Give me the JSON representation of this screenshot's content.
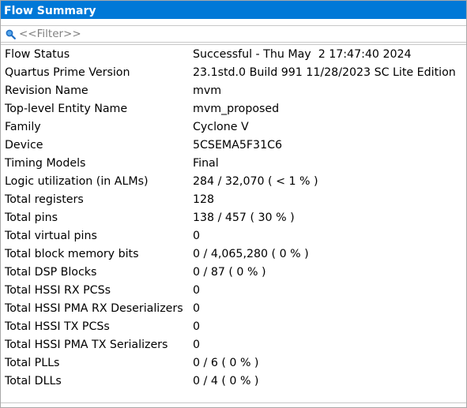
{
  "panel": {
    "title": "Flow Summary"
  },
  "filter": {
    "placeholder": "<<Filter>>",
    "value": ""
  },
  "icons": {
    "filter": "search-icon"
  },
  "colors": {
    "title_bg": "#0078d7",
    "title_fg": "#ffffff"
  },
  "rows": [
    {
      "key": "Flow Status",
      "value": "Successful - Thu May  2 17:47:40 2024"
    },
    {
      "key": "Quartus Prime Version",
      "value": "23.1std.0 Build 991 11/28/2023 SC Lite Edition"
    },
    {
      "key": "Revision Name",
      "value": "mvm"
    },
    {
      "key": "Top-level Entity Name",
      "value": "mvm_proposed"
    },
    {
      "key": "Family",
      "value": "Cyclone V"
    },
    {
      "key": "Device",
      "value": "5CSEMA5F31C6"
    },
    {
      "key": "Timing Models",
      "value": "Final"
    },
    {
      "key": "Logic utilization (in ALMs)",
      "value": "284 / 32,070 ( < 1 % )"
    },
    {
      "key": "Total registers",
      "value": "128"
    },
    {
      "key": "Total pins",
      "value": "138 / 457 ( 30 % )"
    },
    {
      "key": "Total virtual pins",
      "value": "0"
    },
    {
      "key": "Total block memory bits",
      "value": "0 / 4,065,280 ( 0 % )"
    },
    {
      "key": "Total DSP Blocks",
      "value": "0 / 87 ( 0 % )"
    },
    {
      "key": "Total HSSI RX PCSs",
      "value": "0"
    },
    {
      "key": "Total HSSI PMA RX Deserializers",
      "value": "0"
    },
    {
      "key": "Total HSSI TX PCSs",
      "value": "0"
    },
    {
      "key": "Total HSSI PMA TX Serializers",
      "value": "0"
    },
    {
      "key": "Total PLLs",
      "value": "0 / 6 ( 0 % )"
    },
    {
      "key": "Total DLLs",
      "value": "0 / 4 ( 0 % )"
    }
  ]
}
